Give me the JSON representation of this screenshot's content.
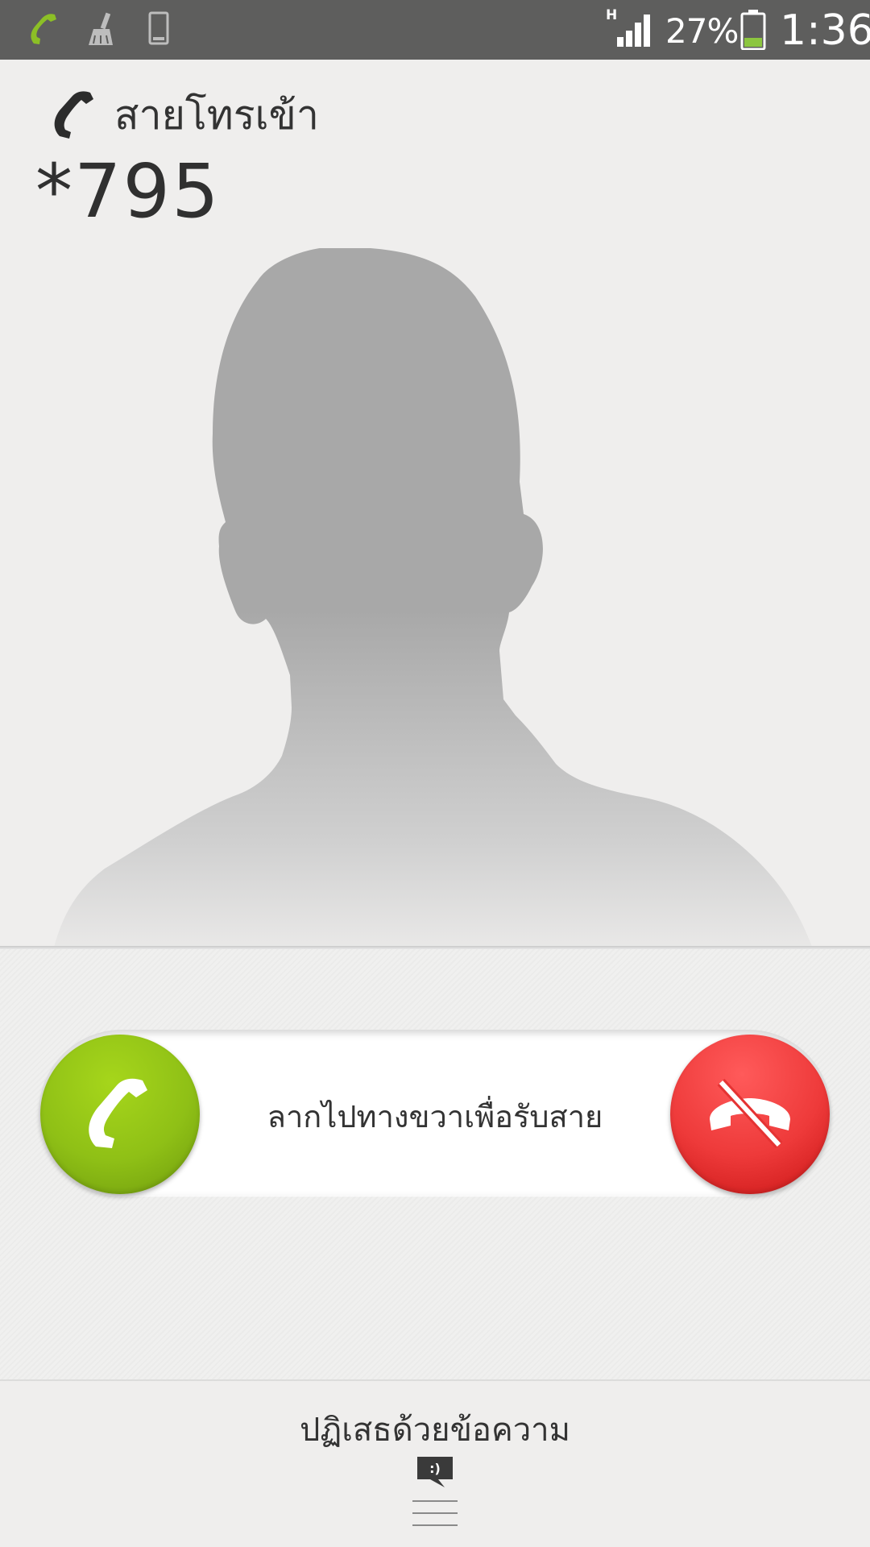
{
  "status_bar": {
    "notification_icons": [
      "call-icon",
      "broom-icon",
      "phone-device-icon"
    ],
    "network_type": "H",
    "battery_percent": "27%",
    "battery_level": 0.27,
    "time": "1:36"
  },
  "caller": {
    "incoming_label": "สายโทรเข้า",
    "number": "*795"
  },
  "answer_slider": {
    "hint": "ลากไปทางขวาเพื่อรับสาย",
    "answer_color": "#8fc016",
    "decline_color": "#ee3a3a"
  },
  "bottom": {
    "reject_with_message": "ปฏิเสธด้วยข้อความ",
    "message_icon_text": ":)"
  }
}
